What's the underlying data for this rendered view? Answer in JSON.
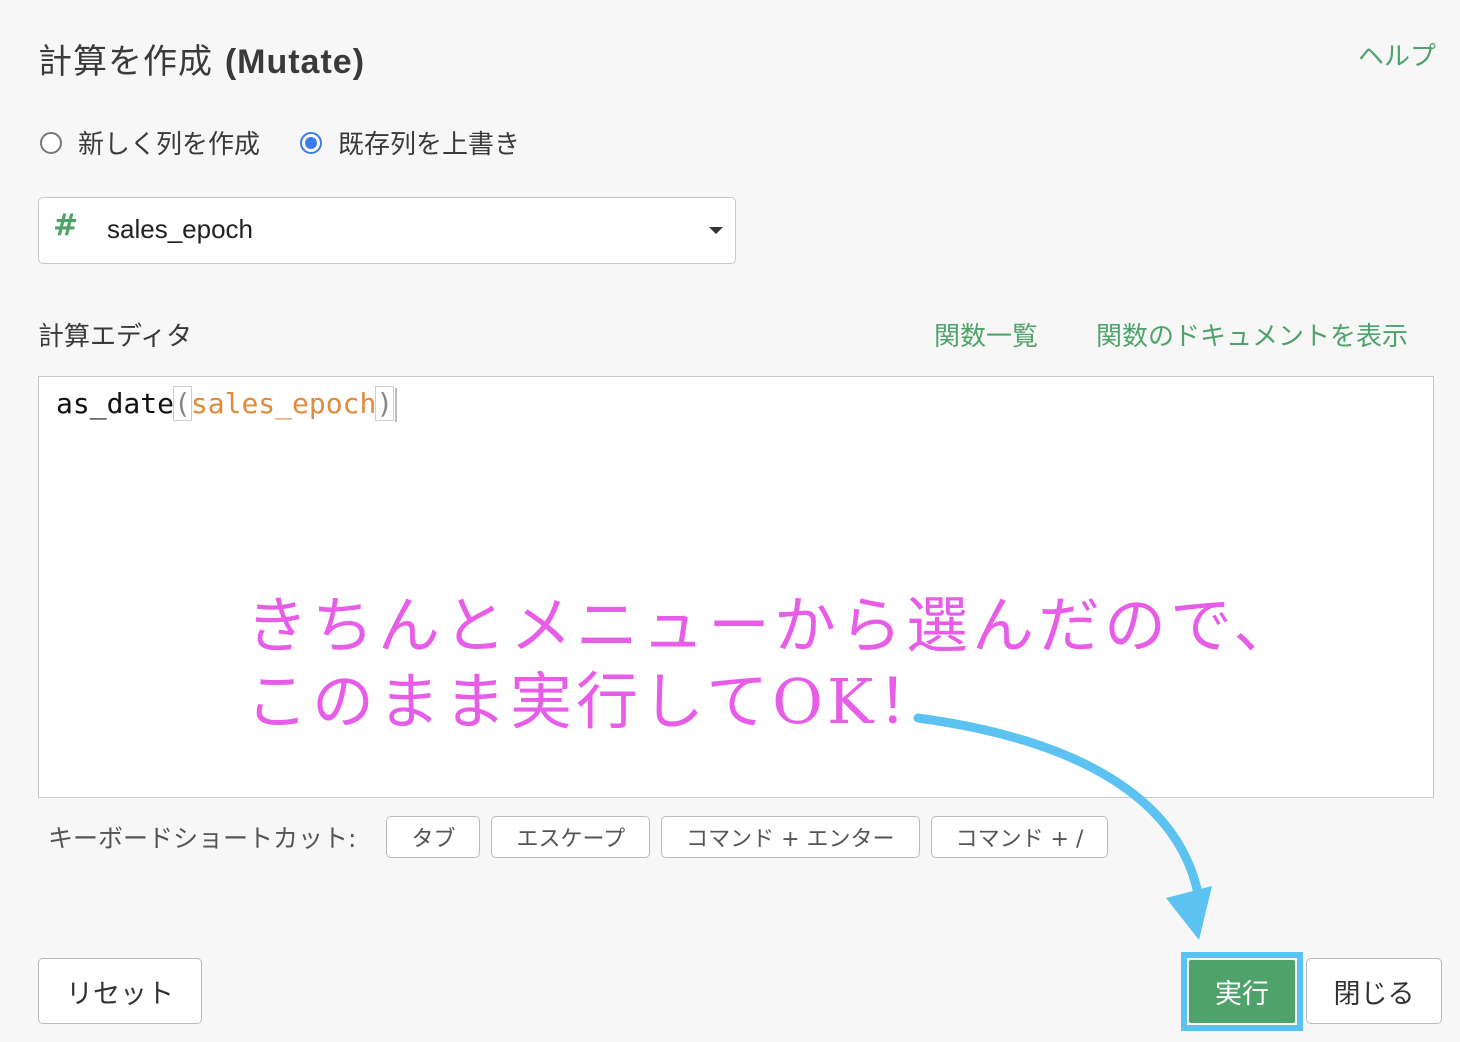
{
  "header": {
    "title_jp": "計算を作成 ",
    "title_en": "(Mutate)",
    "help_label": "ヘルプ"
  },
  "mode": {
    "options": [
      {
        "label": "新しく列を作成",
        "checked": false
      },
      {
        "label": "既存列を上書き",
        "checked": true
      }
    ]
  },
  "column_select": {
    "type_icon": "#",
    "value": "sales_epoch"
  },
  "editor": {
    "label": "計算エディタ",
    "function_list_link": "関数一覧",
    "function_docs_link": "関数のドキュメントを表示",
    "code": {
      "func": "as_date",
      "open_paren": "(",
      "arg": "sales_epoch",
      "close_paren": ")"
    }
  },
  "annotation": {
    "line1": "きちんとメニューから選んだので、",
    "line2": "このまま実行してOK！",
    "color": "#e85de8",
    "arrow_color": "#5bc2f2"
  },
  "shortcuts": {
    "label": "キーボードショートカット:",
    "keys": [
      "タブ",
      "エスケープ",
      "コマンド + エンター",
      "コマンド + /"
    ]
  },
  "footer": {
    "reset_label": "リセット",
    "run_label": "実行",
    "close_label": "閉じる"
  },
  "colors": {
    "accent_green": "#4fa36a",
    "radio_blue": "#3b7de8",
    "highlight_blue": "#5bc2f2"
  }
}
